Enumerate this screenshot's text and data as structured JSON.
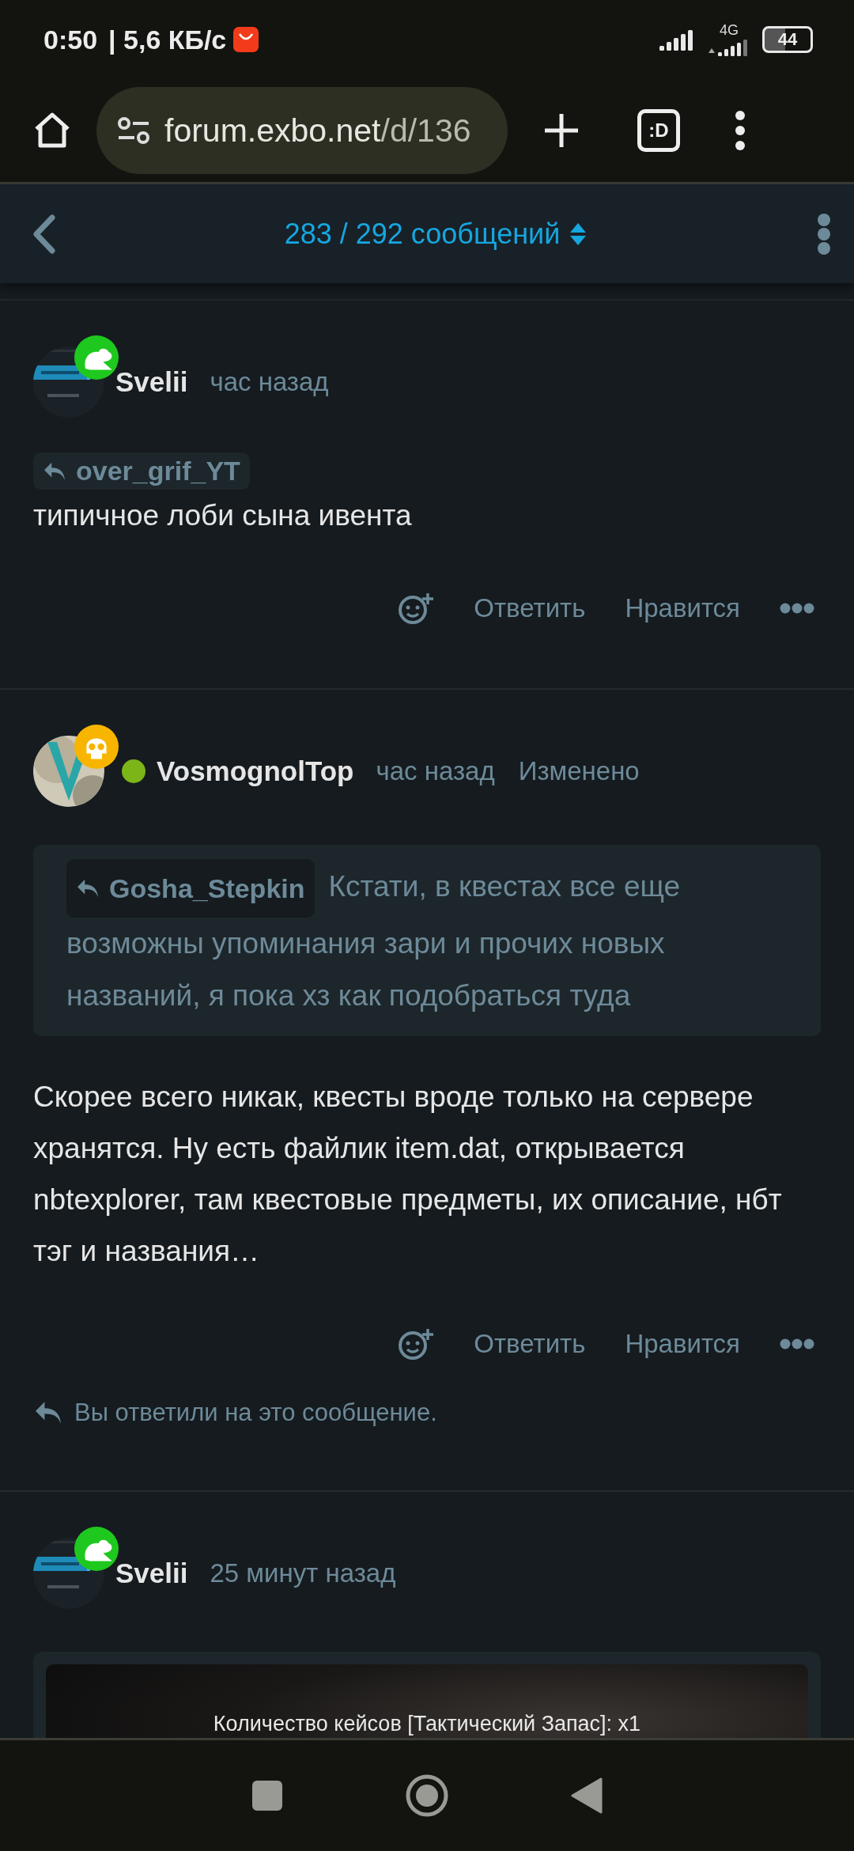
{
  "status_bar": {
    "time": "0:50",
    "speed": "| 5,6 КБ/с",
    "network": "4G",
    "battery": "44"
  },
  "browser": {
    "url_host": "forum.exbo.net",
    "url_path": "/d/136",
    "tab_count": ":D"
  },
  "discussion_header": {
    "counter": "283 / 292 сообщений"
  },
  "posts": [
    {
      "author": "Svelii",
      "time": "час назад",
      "badge": {
        "kind": "frog",
        "color": "#1ec81e"
      },
      "online": false,
      "reply_to": "over_grif_YT",
      "body": "типичное лоби сына ивента",
      "actions": [
        "Ответить",
        "Нравится"
      ]
    },
    {
      "author": "VosmognolTop",
      "time": "час назад",
      "edited": "Изменено",
      "badge": {
        "kind": "skull",
        "color": "#f7b500"
      },
      "online": true,
      "quote": {
        "reply_to": "Gosha_Stepkin",
        "text": "Кстати, в квестах все еще возможны упоминания зари и прочих новых названий, я пока хз как подобраться туда"
      },
      "body": "Скорее всего никак, квесты вроде только на сервере хранятся. Ну есть файлик item.dat, открывается nbtexplorer, там квестовые предметы, их описание, нбт тэг и названия…",
      "actions": [
        "Ответить",
        "Нравится"
      ],
      "note": "Вы ответили на это сообщение."
    },
    {
      "author": "Svelii",
      "time": "25 минут назад",
      "badge": {
        "kind": "frog",
        "color": "#1ec81e"
      },
      "online": false,
      "image": {
        "caption": "Количество кейсов [Тактический Запас]:  x1"
      }
    }
  ]
}
